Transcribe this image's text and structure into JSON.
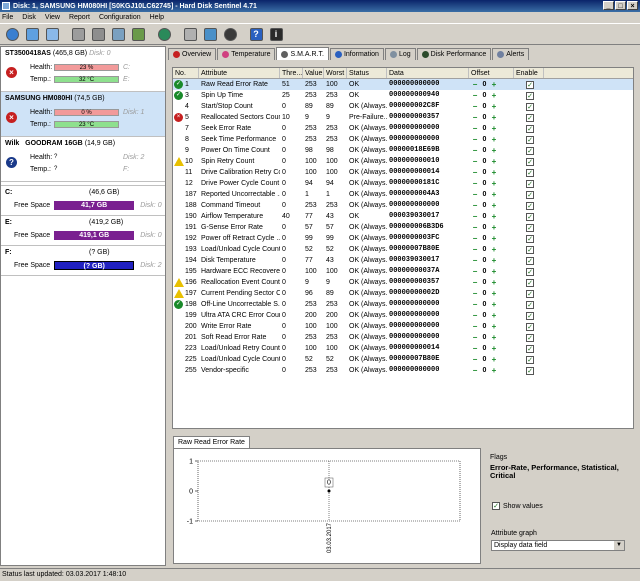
{
  "window": {
    "title": "Disk: 1, SAMSUNG HM080HI [S0KGJ10LC62745]  -  Hard Disk Sentinel 4.71",
    "min": "_",
    "max": "□",
    "close": "×"
  },
  "menu": [
    "File",
    "Disk",
    "View",
    "Report",
    "Configuration",
    "Help"
  ],
  "toolbar": [
    "refresh-icon",
    "disk-info-icon",
    "alert-icon",
    "test-icon",
    "tools-icon",
    "surface-icon",
    "settings-icon",
    "globe-icon",
    "backup-icon",
    "schedule-icon",
    "power-icon",
    "help-icon",
    "info-icon"
  ],
  "disks": [
    {
      "name": "ST3500418AS",
      "size": "(465,8 GB)",
      "index": "Disk: 0",
      "status": "bad",
      "health_label": "Health:",
      "health": "23 %",
      "health_pct": 23,
      "temp_label": "Temp.:",
      "temp": "32 °C",
      "letters1": "C:",
      "letters2": "E:"
    },
    {
      "name": "SAMSUNG HM080HI",
      "size": "(74,5 GB)",
      "index": "Disk: 1",
      "status": "bad",
      "health_label": "Health:",
      "health": "0 %",
      "health_pct": 0,
      "temp_label": "Temp.:",
      "temp": "23 °C",
      "letters1": "",
      "letters2": ""
    },
    {
      "name": "Wilk",
      "name2": "GOODRAM 16GB",
      "size": "(14,9 GB)",
      "index": "Disk: 2",
      "status": "unknown",
      "health_label": "Health:",
      "health": "?",
      "temp_label": "Temp.:",
      "temp": "?",
      "letters1": "F:",
      "letters2": ""
    }
  ],
  "volumes": [
    {
      "letter": "C:",
      "size": "(46,6 GB)",
      "free_label": "Free Space",
      "free": "41,7 GB",
      "disk": "Disk: 0"
    },
    {
      "letter": "E:",
      "size": "(419,2 GB)",
      "free_label": "Free Space",
      "free": "419,1 GB",
      "disk": "Disk: 0"
    },
    {
      "letter": "F:",
      "size": "(? GB)",
      "free_label": "Free Space",
      "free": "(? GB)",
      "disk": "Disk: 2"
    }
  ],
  "tabs": [
    "Overview",
    "Temperature",
    "S.M.A.R.T.",
    "Information",
    "Log",
    "Disk Performance",
    "Alerts"
  ],
  "smart": {
    "headers": [
      "No.",
      "Attribute",
      "Thre...",
      "Value",
      "Worst",
      "Status",
      "Data",
      "Offset",
      "Enable"
    ],
    "rows": [
      {
        "no": "1",
        "attr": "Raw Read Error Rate",
        "th": "51",
        "val": "253",
        "worst": "100",
        "status": "OK",
        "data": "000000000000",
        "icon": "ok",
        "sel": true
      },
      {
        "no": "3",
        "attr": "Spin Up Time",
        "th": "25",
        "val": "253",
        "worst": "253",
        "status": "OK",
        "data": "000000000940",
        "icon": "ok"
      },
      {
        "no": "4",
        "attr": "Start/Stop Count",
        "th": "0",
        "val": "89",
        "worst": "89",
        "status": "OK (Always...",
        "data": "000000002C8F",
        "icon": ""
      },
      {
        "no": "5",
        "attr": "Reallocated Sectors Count",
        "th": "10",
        "val": "9",
        "worst": "9",
        "status": "Pre-Failure...",
        "data": "000000000357",
        "icon": "bad"
      },
      {
        "no": "7",
        "attr": "Seek Error Rate",
        "th": "0",
        "val": "253",
        "worst": "253",
        "status": "OK (Always...",
        "data": "000000000000",
        "icon": ""
      },
      {
        "no": "8",
        "attr": "Seek Time Performance",
        "th": "0",
        "val": "253",
        "worst": "253",
        "status": "OK (Always...",
        "data": "000000000000",
        "icon": ""
      },
      {
        "no": "9",
        "attr": "Power On Time Count",
        "th": "0",
        "val": "98",
        "worst": "98",
        "status": "OK (Always...",
        "data": "00000018E69B",
        "icon": ""
      },
      {
        "no": "10",
        "attr": "Spin Retry Count",
        "th": "0",
        "val": "100",
        "worst": "100",
        "status": "OK (Always...",
        "data": "000000000010",
        "icon": "warn"
      },
      {
        "no": "11",
        "attr": "Drive Calibration Retry Co...",
        "th": "0",
        "val": "100",
        "worst": "100",
        "status": "OK (Always...",
        "data": "000000000014",
        "icon": ""
      },
      {
        "no": "12",
        "attr": "Drive Power Cycle Count",
        "th": "0",
        "val": "94",
        "worst": "94",
        "status": "OK (Always...",
        "data": "00000000181C",
        "icon": ""
      },
      {
        "no": "187",
        "attr": "Reported Uncorrectable ...",
        "th": "0",
        "val": "1",
        "worst": "1",
        "status": "OK (Always...",
        "data": "0000000004A3",
        "icon": ""
      },
      {
        "no": "188",
        "attr": "Command Timeout",
        "th": "0",
        "val": "253",
        "worst": "253",
        "status": "OK (Always...",
        "data": "000000000000",
        "icon": ""
      },
      {
        "no": "190",
        "attr": "Airflow Temperature",
        "th": "40",
        "val": "77",
        "worst": "43",
        "status": "OK",
        "data": "000039030017",
        "icon": ""
      },
      {
        "no": "191",
        "attr": "G-Sense Error Rate",
        "th": "0",
        "val": "57",
        "worst": "57",
        "status": "OK (Always...",
        "data": "000000006B3D6",
        "icon": ""
      },
      {
        "no": "192",
        "attr": "Power off Retract Cycle ...",
        "th": "0",
        "val": "99",
        "worst": "99",
        "status": "OK (Always...",
        "data": "0000000003FC",
        "icon": ""
      },
      {
        "no": "193",
        "attr": "Load/Unload Cycle Count",
        "th": "0",
        "val": "52",
        "worst": "52",
        "status": "OK (Always...",
        "data": "00000007B80E",
        "icon": ""
      },
      {
        "no": "194",
        "attr": "Disk Temperature",
        "th": "0",
        "val": "77",
        "worst": "43",
        "status": "OK (Always...",
        "data": "000039030017",
        "icon": ""
      },
      {
        "no": "195",
        "attr": "Hardware ECC Recovered",
        "th": "0",
        "val": "100",
        "worst": "100",
        "status": "OK (Always...",
        "data": "00000000037A",
        "icon": ""
      },
      {
        "no": "196",
        "attr": "Reallocation Event Count",
        "th": "0",
        "val": "9",
        "worst": "9",
        "status": "OK (Always...",
        "data": "000000000357",
        "icon": "warn"
      },
      {
        "no": "197",
        "attr": "Current Pending Sector C...",
        "th": "0",
        "val": "96",
        "worst": "89",
        "status": "OK (Always...",
        "data": "00000000002D",
        "icon": "warn"
      },
      {
        "no": "198",
        "attr": "Off-Line Uncorrectable S...",
        "th": "0",
        "val": "253",
        "worst": "253",
        "status": "OK (Always...",
        "data": "000000000000",
        "icon": "ok"
      },
      {
        "no": "199",
        "attr": "Ultra ATA CRC Error Count",
        "th": "0",
        "val": "200",
        "worst": "200",
        "status": "OK (Always...",
        "data": "000000000000",
        "icon": ""
      },
      {
        "no": "200",
        "attr": "Write Error Rate",
        "th": "0",
        "val": "100",
        "worst": "100",
        "status": "OK (Always...",
        "data": "000000000000",
        "icon": ""
      },
      {
        "no": "201",
        "attr": "Soft Read Error Rate",
        "th": "0",
        "val": "253",
        "worst": "253",
        "status": "OK (Always...",
        "data": "000000000000",
        "icon": ""
      },
      {
        "no": "223",
        "attr": "Load/Unload Retry Count",
        "th": "0",
        "val": "100",
        "worst": "100",
        "status": "OK (Always...",
        "data": "000000000014",
        "icon": ""
      },
      {
        "no": "225",
        "attr": "Load/Unload Cycle Count",
        "th": "0",
        "val": "52",
        "worst": "52",
        "status": "OK (Always...",
        "data": "00000007B80E",
        "icon": ""
      },
      {
        "no": "255",
        "attr": "Vendor-specific",
        "th": "0",
        "val": "253",
        "worst": "253",
        "status": "OK (Always...",
        "data": "000000000000",
        "icon": ""
      }
    ],
    "offset_value": "0",
    "minus": "−",
    "plus": "+",
    "check": "✓"
  },
  "graph": {
    "tab": "Raw Read Error Rate",
    "y_ticks": [
      "1",
      "0",
      "-1"
    ],
    "point_label": "0",
    "date_label": "03.03.2017"
  },
  "flags": {
    "title": "Flags",
    "value": "Error-Rate, Performance, Statistical, Critical",
    "show_values": "Show values",
    "attr_graph_label": "Attribute graph",
    "attr_graph_value": "Display data field"
  },
  "status": "Status last updated: 03.03.2017 1:48:10",
  "chart_data": {
    "type": "line",
    "x": [
      "03.03.2017"
    ],
    "series": [
      {
        "values": [
          0
        ]
      }
    ],
    "ylim": [
      -1,
      1
    ]
  }
}
